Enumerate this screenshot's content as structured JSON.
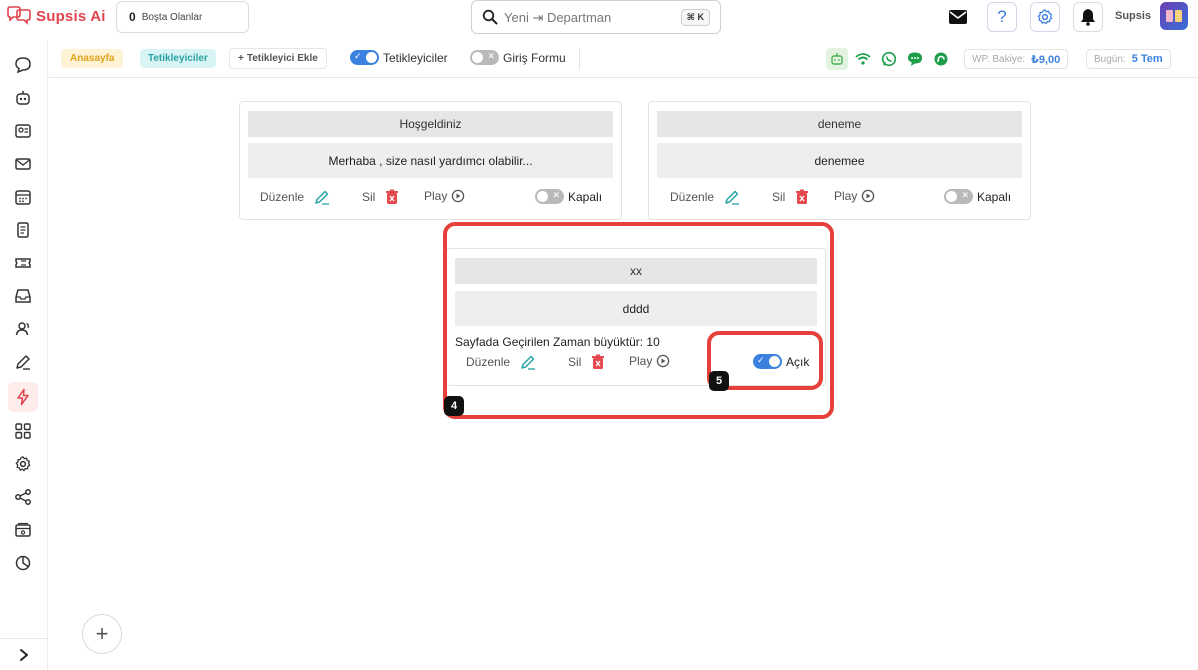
{
  "app": {
    "name": "Supsis Ai",
    "brand_color": "#e0444d",
    "accent_color": "#3b82e0"
  },
  "topbar": {
    "idle_count": "0",
    "idle_label": "Boşta Olanlar",
    "search_placeholder": "Yeni ⇥ Departman",
    "search_shortcut": "⌘ K",
    "help_label": "?",
    "user_name": "Supsis"
  },
  "sidebar": {
    "items": [
      {
        "icon": "chat-bubble-icon"
      },
      {
        "icon": "bot-face-icon"
      },
      {
        "icon": "contact-card-icon"
      },
      {
        "icon": "mail-icon"
      },
      {
        "icon": "calendar-icon"
      },
      {
        "icon": "document-icon"
      },
      {
        "icon": "ticket-icon"
      },
      {
        "icon": "inbox-tray-icon"
      },
      {
        "icon": "users-icon"
      },
      {
        "icon": "pen-icon"
      },
      {
        "icon": "lightning-icon",
        "active": true
      },
      {
        "icon": "grid-icon"
      },
      {
        "icon": "settings-gear-icon"
      },
      {
        "icon": "share-nodes-icon"
      },
      {
        "icon": "payment-icon"
      },
      {
        "icon": "pie-chart-icon"
      }
    ],
    "expand_icon": "chevron-right-icon"
  },
  "subbar": {
    "home_label": "Anasayfa",
    "triggers_label": "Tetikleyiciler",
    "add_trigger_label": "Tetikleyici Ekle",
    "toggle_triggers_label": "Tetikleyiciler",
    "toggle_triggers_on": true,
    "toggle_login_form_label": "Giriş Formu",
    "toggle_login_form_on": false,
    "balance_label": "WP. Bakiye:",
    "balance_value": "₺9,00",
    "today_label": "Bugün:",
    "today_value": "5 Tem"
  },
  "actions": {
    "edit": "Düzenle",
    "delete": "Sil",
    "play": "Play"
  },
  "cards": [
    {
      "title": "Hoşgeldiniz",
      "message": "Merhaba , size nasıl yardımcı olabilir...",
      "status": "Kapalı",
      "enabled": false
    },
    {
      "title": "deneme",
      "message": "denemee",
      "status": "Kapalı",
      "enabled": false
    },
    {
      "title": "xx",
      "message": "dddd",
      "condition": "Sayfada Geçirilen Zaman büyüktür: 10",
      "status": "Açık",
      "enabled": true
    }
  ],
  "annotations": {
    "card_badge": "4",
    "toggle_badge": "5",
    "color": "#e6403a"
  }
}
